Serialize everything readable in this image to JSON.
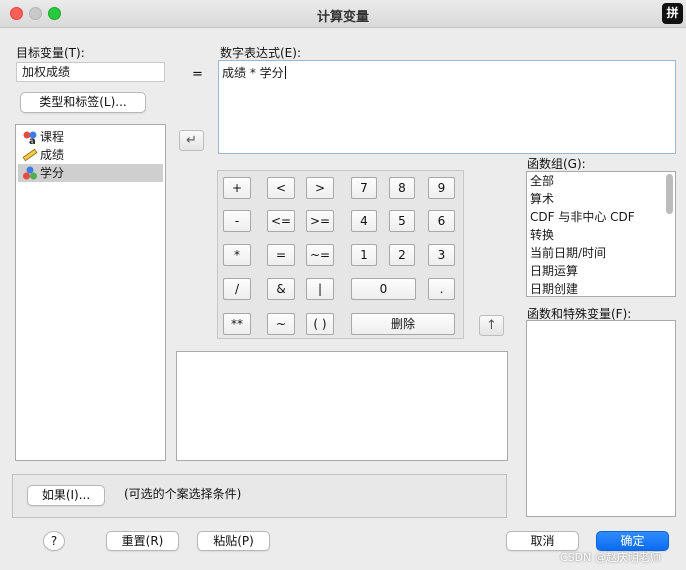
{
  "window": {
    "title": "计算变量",
    "ime_indicator": "拼"
  },
  "target": {
    "label": "目标变量(T):",
    "value": "加权成绩",
    "type_label_button": "类型和标签(L)..."
  },
  "equals": "=",
  "expression": {
    "label": "数字表达式(E):",
    "value": "成绩 * 学分"
  },
  "variables": [
    {
      "name": "课程",
      "icon": "string-variable-icon",
      "selected": false
    },
    {
      "name": "成绩",
      "icon": "scale-variable-icon",
      "selected": false
    },
    {
      "name": "学分",
      "icon": "nominal-variable-icon",
      "selected": true
    }
  ],
  "keypad": {
    "row1": [
      "+",
      "<",
      ">",
      "7",
      "8",
      "9"
    ],
    "row2": [
      "-",
      "<=",
      ">=",
      "4",
      "5",
      "6"
    ],
    "row3": [
      "*",
      "=",
      "~=",
      "1",
      "2",
      "3"
    ],
    "row4": [
      "/",
      "&",
      "|",
      "0",
      "."
    ],
    "row5": [
      "**",
      "~",
      "( )",
      "删除"
    ]
  },
  "function_group": {
    "label": "函数组(G):",
    "items": [
      "全部",
      "算术",
      "CDF 与非中心 CDF",
      "转换",
      "当前日期/时间",
      "日期运算",
      "日期创建"
    ]
  },
  "functions": {
    "label": "函数和特殊变量(F):"
  },
  "if_section": {
    "button": "如果(I)...",
    "note": "(可选的个案选择条件)"
  },
  "footer": {
    "help": "?",
    "reset": "重置(R)",
    "paste": "粘贴(P)",
    "cancel": "取消",
    "ok": "确定"
  },
  "watermark": "CSDN @赵庆明老师",
  "colors": {
    "primary": "#0a6cf0",
    "selected_row": "#cfcfcf"
  }
}
